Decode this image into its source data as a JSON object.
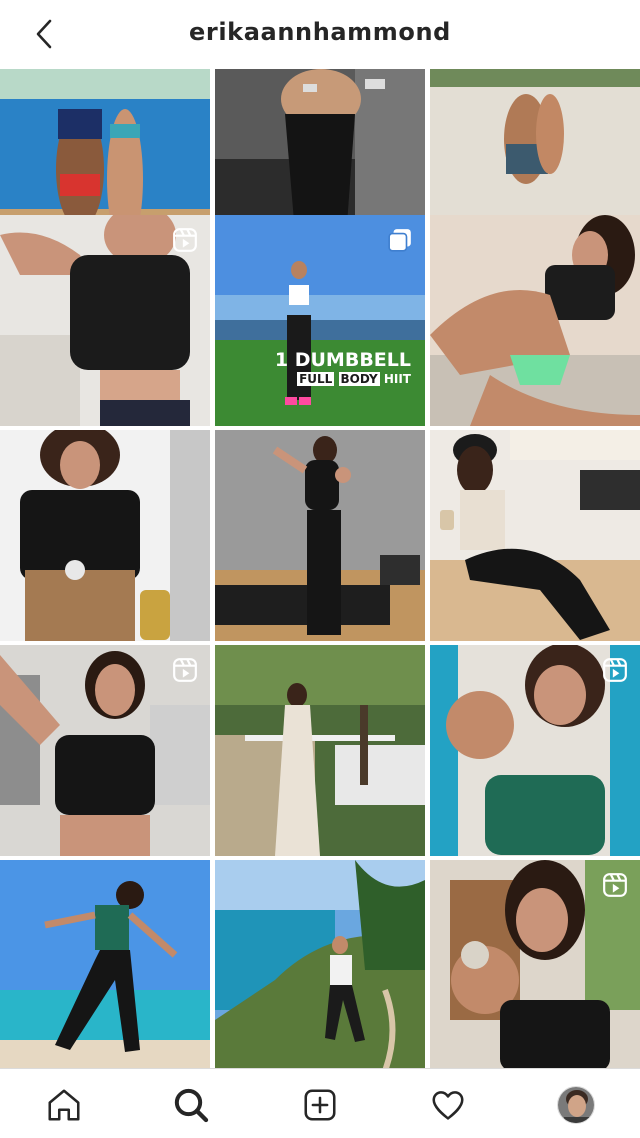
{
  "header": {
    "username": "erikaannhammond"
  },
  "icons": {
    "back": "chevron-left-icon",
    "reel": "reel-icon",
    "carousel": "carousel-icon",
    "home": "home-icon",
    "search": "search-icon",
    "new_post": "new-post-icon",
    "activity": "heart-icon",
    "profile": "profile-avatar"
  },
  "grid": {
    "posts": [
      {
        "badge": "none",
        "text": ""
      },
      {
        "badge": "none",
        "text": ""
      },
      {
        "badge": "none",
        "text": ""
      },
      {
        "badge": "reel",
        "text": ""
      },
      {
        "badge": "carousel",
        "text": "1 DUMBBELL FULL BODY HIIT"
      },
      {
        "badge": "none",
        "text": ""
      },
      {
        "badge": "none",
        "text": ""
      },
      {
        "badge": "none",
        "text": ""
      },
      {
        "badge": "none",
        "text": ""
      },
      {
        "badge": "reel",
        "text": ""
      },
      {
        "badge": "none",
        "text": ""
      },
      {
        "badge": "reel",
        "text": ""
      },
      {
        "badge": "none",
        "text": ""
      },
      {
        "badge": "none",
        "text": ""
      },
      {
        "badge": "reel",
        "text": ""
      }
    ],
    "post5_overlay": {
      "line1": "1 DUMBBELL",
      "line2a": "FULL",
      "line2b": "BODY",
      "line2c": "HIIT"
    }
  },
  "colors": {
    "text": "#262626",
    "border": "#dbdbdb",
    "background": "#ffffff"
  }
}
